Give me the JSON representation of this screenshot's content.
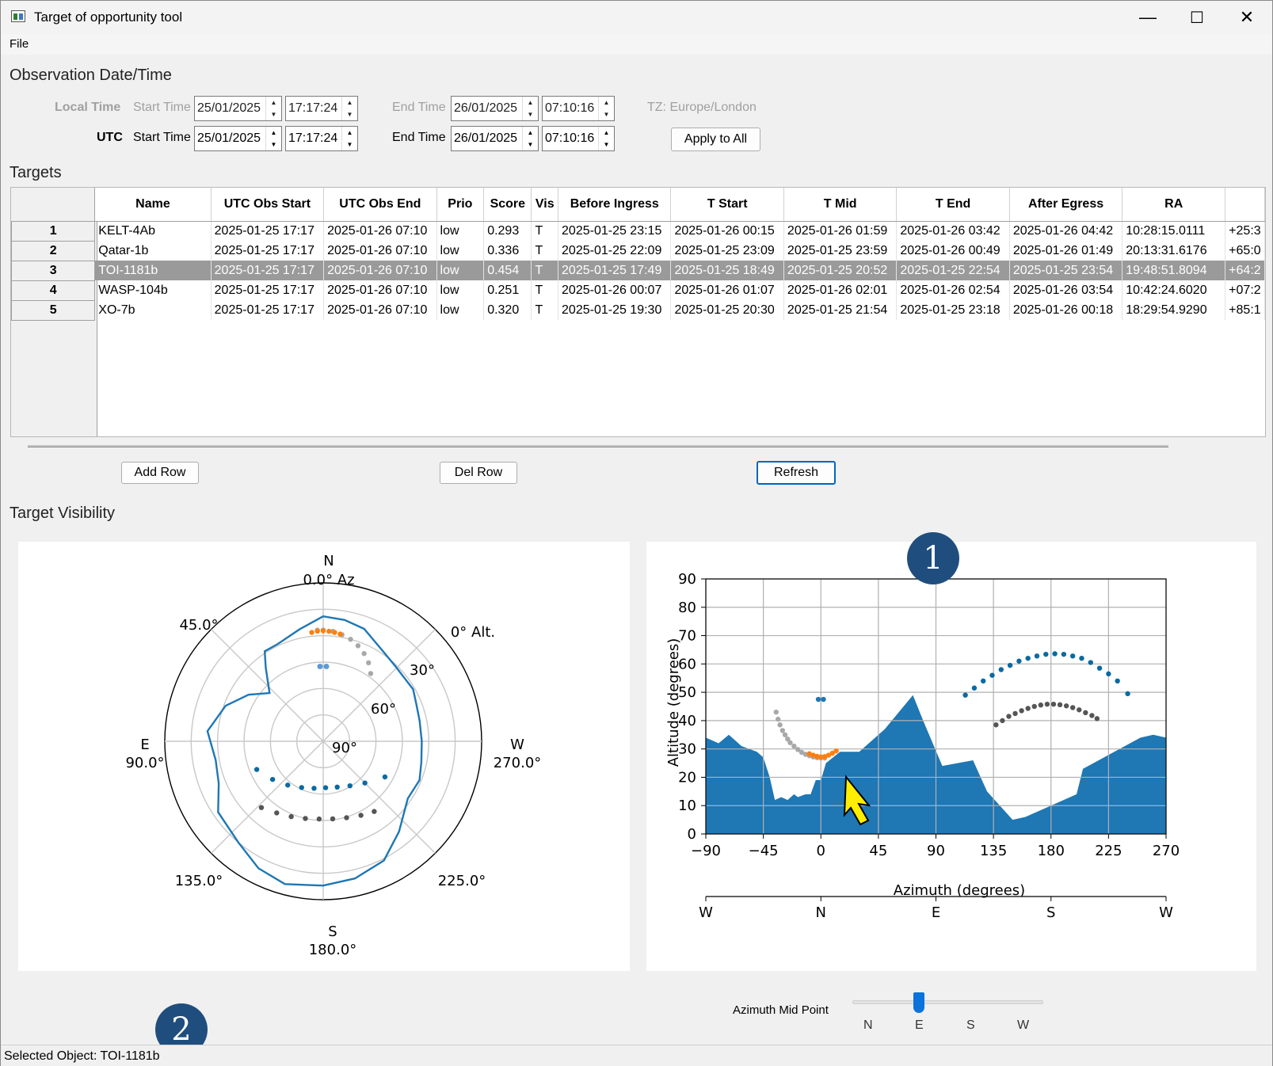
{
  "window": {
    "title": "Target of opportunity tool",
    "minimize": "—",
    "maximize": "☐",
    "close": "✕"
  },
  "menu": {
    "file": "File"
  },
  "observation": {
    "section_label": "Observation Date/Time",
    "local_label": "Local Time",
    "utc_label": "UTC",
    "start_time_label": "Start Time",
    "end_time_label": "End Time",
    "local_start_date": "25/01/2025",
    "local_start_time": "17:17:24",
    "local_end_date": "26/01/2025",
    "local_end_time": "07:10:16",
    "utc_start_date": "25/01/2025",
    "utc_start_time": "17:17:24",
    "utc_end_date": "26/01/2025",
    "utc_end_time": "07:10:16",
    "tz_label": "TZ: Europe/London",
    "apply_all": "Apply to All"
  },
  "targets": {
    "section_label": "Targets",
    "columns": [
      "Name",
      "UTC Obs Start",
      "UTC Obs End",
      "Prio",
      "Score",
      "Vis",
      "Before Ingress",
      "T Start",
      "T Mid",
      "T End",
      "After Egress",
      "RA",
      ""
    ],
    "rows": [
      {
        "id": "1",
        "cells": [
          "KELT-4Ab",
          "2025-01-25 17:17",
          "2025-01-26 07:10",
          "low",
          "0.293",
          "T",
          "2025-01-25 23:15",
          "2025-01-26 00:15",
          "2025-01-26 01:59",
          "2025-01-26 03:42",
          "2025-01-26 04:42",
          "10:28:15.0111",
          "+25:3"
        ]
      },
      {
        "id": "2",
        "cells": [
          "Qatar-1b",
          "2025-01-25 17:17",
          "2025-01-26 07:10",
          "low",
          "0.336",
          "T",
          "2025-01-25 22:09",
          "2025-01-25 23:09",
          "2025-01-25 23:59",
          "2025-01-26 00:49",
          "2025-01-26 01:49",
          "20:13:31.6176",
          "+65:0"
        ]
      },
      {
        "id": "3",
        "cells": [
          "TOI-1181b",
          "2025-01-25 17:17",
          "2025-01-26 07:10",
          "low",
          "0.454",
          "T",
          "2025-01-25 17:49",
          "2025-01-25 18:49",
          "2025-01-25 20:52",
          "2025-01-25 22:54",
          "2025-01-25 23:54",
          "19:48:51.8094",
          "+64:2"
        ]
      },
      {
        "id": "4",
        "cells": [
          "WASP-104b",
          "2025-01-25 17:17",
          "2025-01-26 07:10",
          "low",
          "0.251",
          "T",
          "2025-01-26 00:07",
          "2025-01-26 01:07",
          "2025-01-26 02:01",
          "2025-01-26 02:54",
          "2025-01-26 03:54",
          "10:42:24.6020",
          "+07:2"
        ]
      },
      {
        "id": "5",
        "cells": [
          "XO-7b",
          "2025-01-25 17:17",
          "2025-01-26 07:10",
          "low",
          "0.320",
          "T",
          "2025-01-25 19:30",
          "2025-01-25 20:30",
          "2025-01-25 21:54",
          "2025-01-25 23:18",
          "2025-01-26 00:18",
          "18:29:54.9290",
          "+85:1"
        ]
      }
    ],
    "selected_row": 3,
    "add_row": "Add Row",
    "del_row": "Del Row",
    "refresh": "Refresh"
  },
  "visibility": {
    "section_label": "Target Visibility",
    "polar": {
      "n_label": "N",
      "az0_label": "0.0° Az",
      "e_label": "E",
      "e_deg": "90.0°",
      "w_label": "W",
      "w_deg": "270.0°",
      "s_label": "S",
      "s_deg": "180.0°",
      "d45": "45.0°",
      "d135": "135.0°",
      "d225": "225.0°",
      "alt0": "0° Alt.",
      "alt30": "30°",
      "alt60": "60°",
      "alt90": "90°"
    },
    "azimuth_mid_label": "Azimuth Mid Point",
    "slider_ticks": [
      "N",
      "E",
      "S",
      "W"
    ],
    "slider_value": "E"
  },
  "status": {
    "selected_object": "Selected Object: TOI-1181b"
  },
  "badges": {
    "one": "1",
    "two": "2"
  },
  "colors": {
    "horizon": "#1f77b4",
    "track_blue": "#0a6aa1",
    "track_dark": "#555555",
    "track_gray": "#a8a8a8",
    "transit": "#ff7f0e",
    "sel_row": "#9a9a9a",
    "cursor": "#ffee00"
  },
  "chart_data": [
    {
      "type": "scatter",
      "title": "",
      "xlabel": "Azimuth (degrees)",
      "ylabel": "Altitude (degrees)",
      "xlim": [
        -90,
        270
      ],
      "ylim": [
        0,
        90
      ],
      "xticks": [
        -90,
        -45,
        0,
        45,
        90,
        135,
        180,
        225,
        270
      ],
      "yticks": [
        0,
        10,
        20,
        30,
        40,
        50,
        60,
        70,
        80,
        90
      ],
      "xtick_labels": [
        "−90",
        "−45",
        "0",
        "45",
        "90",
        "135",
        "180",
        "225",
        "270"
      ],
      "compass_axis": [
        "W",
        "N",
        "E",
        "S",
        "W"
      ],
      "grid": true,
      "horizon": {
        "x": [
          -90,
          -80,
          -72,
          -62,
          -50,
          -45,
          -40,
          -36,
          -31,
          -26,
          -21,
          -18,
          -12,
          -8,
          -4,
          0,
          4,
          15,
          30,
          50,
          72,
          80,
          95,
          119,
          130,
          150,
          160,
          180,
          200,
          205,
          250,
          260,
          270
        ],
        "y": [
          34,
          32,
          35,
          31,
          29,
          27,
          20,
          12,
          13,
          12,
          14,
          13,
          14,
          14,
          19,
          19,
          25,
          29,
          29,
          37,
          49,
          40,
          24,
          26,
          15,
          5,
          6,
          10,
          14,
          23,
          34,
          35,
          34
        ]
      },
      "series": [
        {
          "name": "",
          "color": "track_blue",
          "x": [
            113,
            120,
            127,
            134,
            141,
            148,
            155,
            162,
            169,
            176,
            183,
            190,
            197,
            204,
            211,
            218,
            225,
            232,
            240
          ],
          "y": [
            49,
            51.5,
            54,
            56,
            58,
            59.5,
            61,
            62,
            62.8,
            63.4,
            63.6,
            63.4,
            62.8,
            62,
            60.5,
            58.5,
            56.5,
            54,
            49.5
          ]
        },
        {
          "name": "",
          "color": "track_dark",
          "x": [
            137,
            142,
            147,
            152,
            157,
            162,
            167,
            172,
            177,
            182,
            187,
            192,
            197,
            202,
            207,
            212,
            216
          ],
          "y": [
            38.5,
            40,
            41.5,
            42.5,
            43.5,
            44.3,
            45,
            45.5,
            45.8,
            45.8,
            45.6,
            45.2,
            44.6,
            43.8,
            42.8,
            41.8,
            40.7
          ]
        },
        {
          "name": "",
          "color": "track_gray",
          "x": [
            -35,
            -33.5,
            -32,
            -30,
            -28,
            -26,
            -24,
            -21,
            -18,
            -15,
            -12,
            -9,
            -6,
            -3,
            0,
            3
          ],
          "y": [
            43,
            40.5,
            38.5,
            36.5,
            35,
            33.5,
            32.2,
            31,
            29.8,
            28.8,
            28.1,
            27.6,
            27.2,
            26.9,
            26.8,
            26.8
          ]
        },
        {
          "name": "",
          "color": "transit",
          "x": [
            -9,
            -6,
            -3,
            0,
            3,
            6,
            9,
            12
          ],
          "y": [
            28.3,
            27.8,
            27.4,
            27.2,
            27.3,
            27.8,
            28.5,
            29.3
          ]
        },
        {
          "name": "",
          "color": "horizon",
          "x": [
            -2,
            2
          ],
          "y": [
            47.5,
            47.5
          ]
        }
      ]
    },
    {
      "type": "scatter",
      "title": "",
      "coordinate_system": "polar (azimuth, altitude)",
      "rings_alt": [
        0,
        15,
        30,
        45,
        60,
        75,
        90
      ],
      "spokes_az": [
        0,
        45,
        90,
        135,
        180,
        225,
        270,
        315
      ],
      "horizon": {
        "az": [
          0,
          12,
          25,
          33,
          38,
          48,
          58,
          70,
          85,
          100,
          112,
          124,
          140,
          153,
          165,
          180,
          193,
          207,
          220,
          236,
          248,
          258,
          270,
          282,
          292,
          300,
          315,
          325,
          340,
          350
        ],
        "alt": [
          19,
          25,
          29,
          29,
          37,
          49,
          40,
          31,
          24,
          28,
          26,
          18,
          15,
          9,
          6,
          8,
          10,
          14,
          23,
          32,
          31,
          33,
          34,
          34,
          33,
          31,
          31,
          29,
          22,
          20
        ]
      },
      "series": [
        {
          "name": "",
          "color": "track_blue",
          "az": [
            113,
            127,
            141,
            155,
            169,
            183,
            197,
            211,
            225,
            240
          ],
          "alt": [
            49,
            54,
            58,
            61,
            62.8,
            63.6,
            62.8,
            60.5,
            56.5,
            49.5
          ]
        },
        {
          "name": "",
          "color": "track_dark",
          "az": [
            137,
            147,
            157,
            167,
            177,
            187,
            197,
            207,
            216
          ],
          "alt": [
            38.5,
            41.5,
            43.5,
            45,
            45.8,
            45.6,
            44.6,
            42.8,
            40.7
          ]
        },
        {
          "name": "",
          "color": "track_gray",
          "az": [
            325,
            330,
            335,
            340,
            345,
            350,
            355,
            0,
            3
          ],
          "alt": [
            43,
            38.5,
            35,
            32.2,
            30,
            28.5,
            27.3,
            26.8,
            26.8
          ]
        },
        {
          "name": "",
          "color": "transit",
          "az": [
            351,
            354,
            357,
            0,
            3,
            6
          ],
          "alt": [
            28.3,
            27.8,
            27.4,
            27.2,
            27.3,
            27.8
          ]
        }
      ]
    }
  ]
}
